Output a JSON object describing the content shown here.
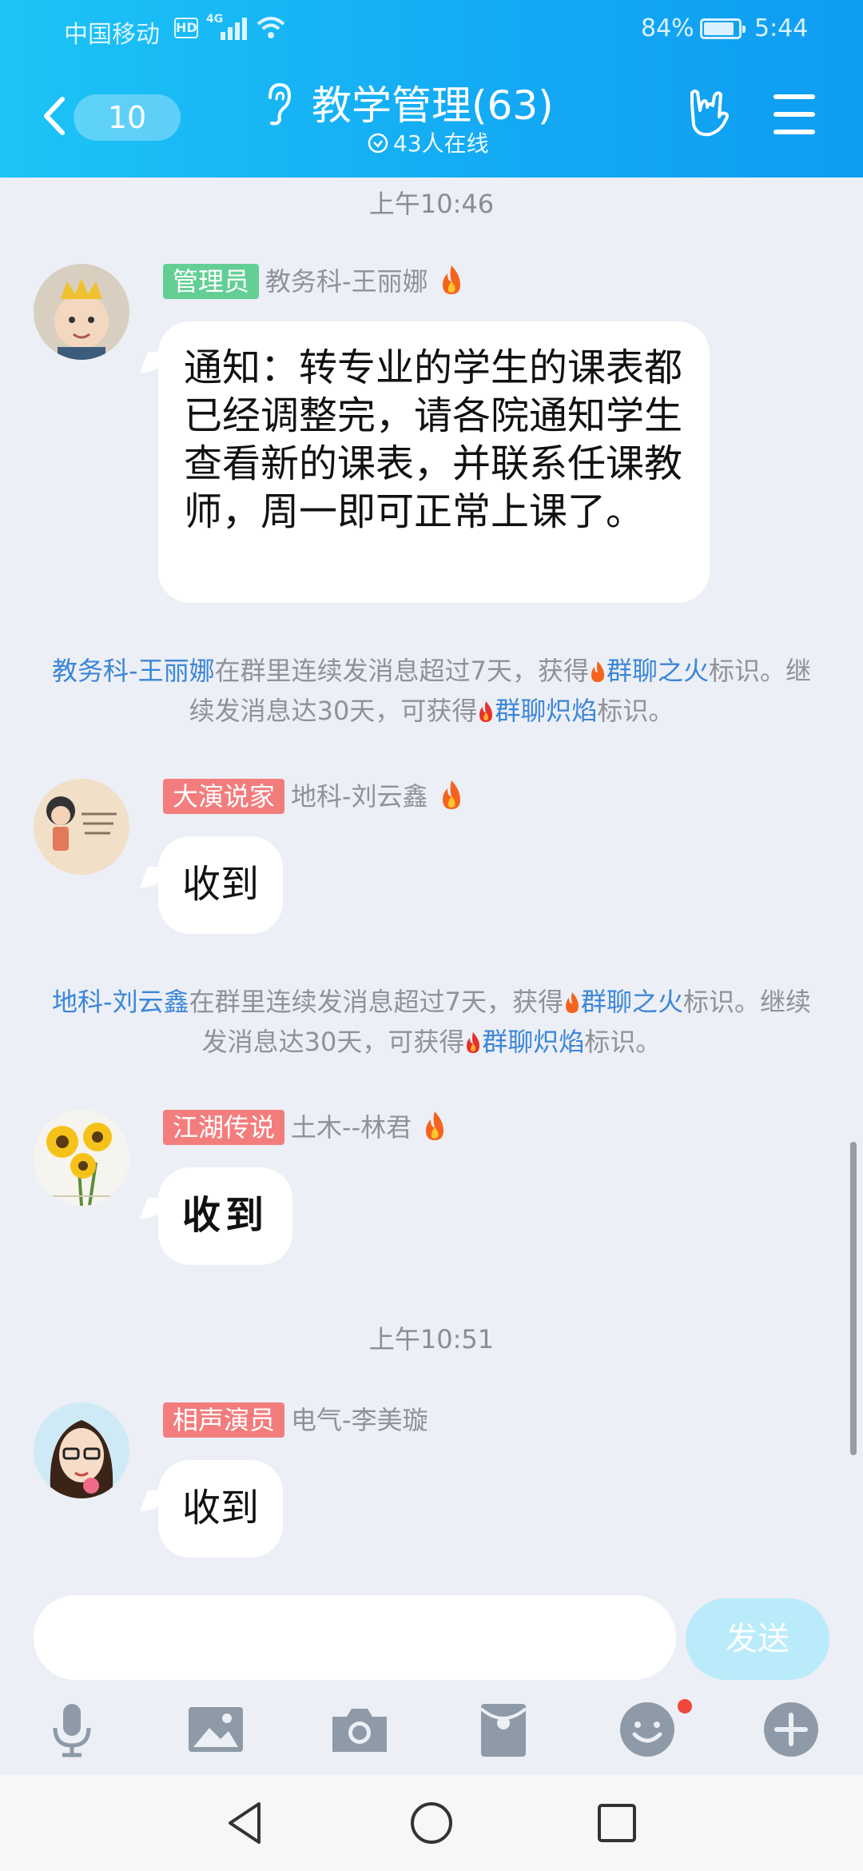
{
  "status_bar": {
    "carrier": "中国移动",
    "hd": "HD",
    "network": "4G",
    "battery_percent": "84%",
    "time": "5:44"
  },
  "header": {
    "back_count": "10",
    "title": "教学管理(63)",
    "online": "43人在线"
  },
  "messages": [
    {
      "time": "上午10:46",
      "badge": "管理员",
      "badge_color": "#63cf94",
      "sender": "教务科-王丽娜",
      "text": "通知：转专业的学生的课表都已经调整完，请各院通知学生查看新的课表，并联系任课教师，周一即可正常上课了。"
    },
    {
      "badge": "大演说家",
      "badge_color": "#f37d7d",
      "sender": "地科-刘云鑫",
      "text": "收到"
    },
    {
      "badge": "江湖传说",
      "badge_color": "#f37d7d",
      "sender": "土木--林君",
      "text": "收到"
    },
    {
      "time": "上午10:51",
      "badge": "相声演员",
      "badge_color": "#f37d7d",
      "sender": "电气-李美璇",
      "text": "收到"
    }
  ],
  "system_notes": [
    {
      "name": "教务科-王丽娜",
      "part1": "在群里连续发消息超过7天，获得",
      "award1": "群聊之火",
      "part2": "标识。继续发消息达30天，可获得",
      "award2": "群聊炽焰",
      "part3": "标识。"
    },
    {
      "name": "地科-刘云鑫",
      "part1": "在群里连续发消息超过7天，获得",
      "award1": "群聊之火",
      "part2": "标识。继续发消息达30天，可获得",
      "award2": "群聊炽焰",
      "part3": "标识。"
    }
  ],
  "input": {
    "value": "",
    "send_label": "发送"
  },
  "toolbar_icons": [
    "microphone-icon",
    "image-icon",
    "camera-icon",
    "red-packet-icon",
    "emoji-icon",
    "plus-icon"
  ],
  "colors": {
    "header_start": "#1cc4f6",
    "header_end": "#0f9df1",
    "link_blue": "#3b86d8",
    "chat_bg": "#eceff5"
  }
}
